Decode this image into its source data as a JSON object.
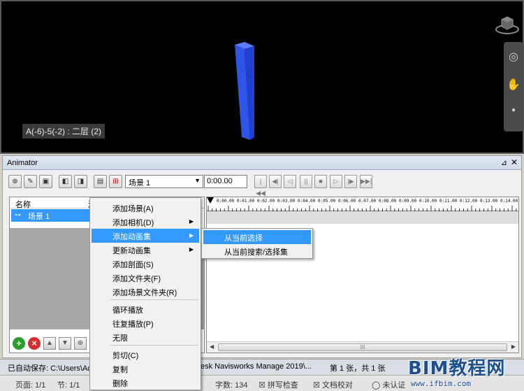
{
  "viewport": {
    "view_label": "A(-6)-5(-2) : 二层 (2)"
  },
  "animator": {
    "title": "Animator",
    "pin_icon": "pin-icon",
    "close_label": "✕",
    "scene_select_value": "场景 1",
    "time_value": "0:00.00",
    "tree": {
      "col_name": "名称",
      "col_active": "活",
      "scene_row": "场景 1"
    },
    "ruler_ticks": [
      "0:00.00",
      "0:01.00",
      "0:02.00",
      "0:03.00",
      "0:04.00",
      "0:05.00",
      "0:06.00",
      "0:07.00",
      "0:08.00",
      "0:09.00",
      "0:10.00",
      "0:11.00",
      "0:12.00",
      "0:13.00",
      "0:14.00",
      "0:15.00"
    ],
    "scroll_grip": "III"
  },
  "context_menu": {
    "items": [
      {
        "label": "添加场景(A)",
        "submenu": false
      },
      {
        "label": "添加相机(D)",
        "submenu": true
      },
      {
        "label": "添加动画集",
        "submenu": true,
        "highlighted": true
      },
      {
        "label": "更新动画集",
        "submenu": true
      },
      {
        "label": "添加剖面(S)",
        "submenu": false
      },
      {
        "label": "添加文件夹(F)",
        "submenu": false
      },
      {
        "label": "添加场景文件夹(R)",
        "submenu": false
      },
      {
        "label": "循环播放",
        "submenu": false
      },
      {
        "label": "往复播放(P)",
        "submenu": false
      },
      {
        "label": "无限",
        "submenu": false
      },
      {
        "label": "剪切(C)",
        "submenu": false
      },
      {
        "label": "复制",
        "submenu": false
      },
      {
        "label": "删除",
        "submenu": false
      }
    ],
    "submenu_items": [
      {
        "label": "从当前选择",
        "highlighted": true
      },
      {
        "label": "从当前搜索/选择集",
        "highlighted": false
      }
    ]
  },
  "status": {
    "autosave": "已自动保存: C:\\Users\\Adı",
    "app_name": "esk Navisworks Manage 2019\\...",
    "page_info": "第 1 张，共 1 张",
    "page": "页面: 1/1",
    "section": "节: 1/1",
    "word_count": "字数: 134",
    "spell_check": "拼写检查",
    "doc_check": "文档校对",
    "cert": "未认证"
  },
  "watermark": {
    "title": "BIM教程网",
    "url": "www.ifbim.com"
  },
  "colors": {
    "highlight": "#3399ff",
    "column_blue": "#2f54e8"
  }
}
